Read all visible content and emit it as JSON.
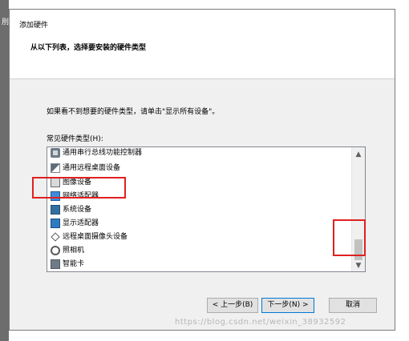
{
  "window": {
    "title": "添加硬件",
    "edge_glyph": "刖"
  },
  "header": {
    "heading": "从以下列表，选择要安装的硬件类型"
  },
  "body": {
    "hint": "如果看不到想要的硬件类型，请单击\"显示所有设备\"。",
    "list_label": "常见硬件类型(H):",
    "items": [
      {
        "label": "通用串行总线功能控制器",
        "icon": "usb-controller-icon"
      },
      {
        "label": "通用远程桌面设备",
        "icon": "remote-desktop-device-icon"
      },
      {
        "label": "图像设备",
        "icon": "imaging-device-icon"
      },
      {
        "label": "网络适配器",
        "icon": "network-adapter-icon"
      },
      {
        "label": "系统设备",
        "icon": "system-device-icon"
      },
      {
        "label": "显示适配器",
        "icon": "display-adapter-icon"
      },
      {
        "label": "远程桌面摄像头设备",
        "icon": "remote-camera-icon"
      },
      {
        "label": "照相机",
        "icon": "camera-icon"
      },
      {
        "label": "智能卡",
        "icon": "smart-card-icon"
      }
    ]
  },
  "buttons": {
    "back": "< 上一步(B)",
    "next": "下一步(N) >",
    "cancel": "取消"
  },
  "watermark": "https://blog.csdn.net/weixin_38932592",
  "colors": {
    "annotation_red": "#e02020",
    "accent_blue": "#0078d7"
  }
}
